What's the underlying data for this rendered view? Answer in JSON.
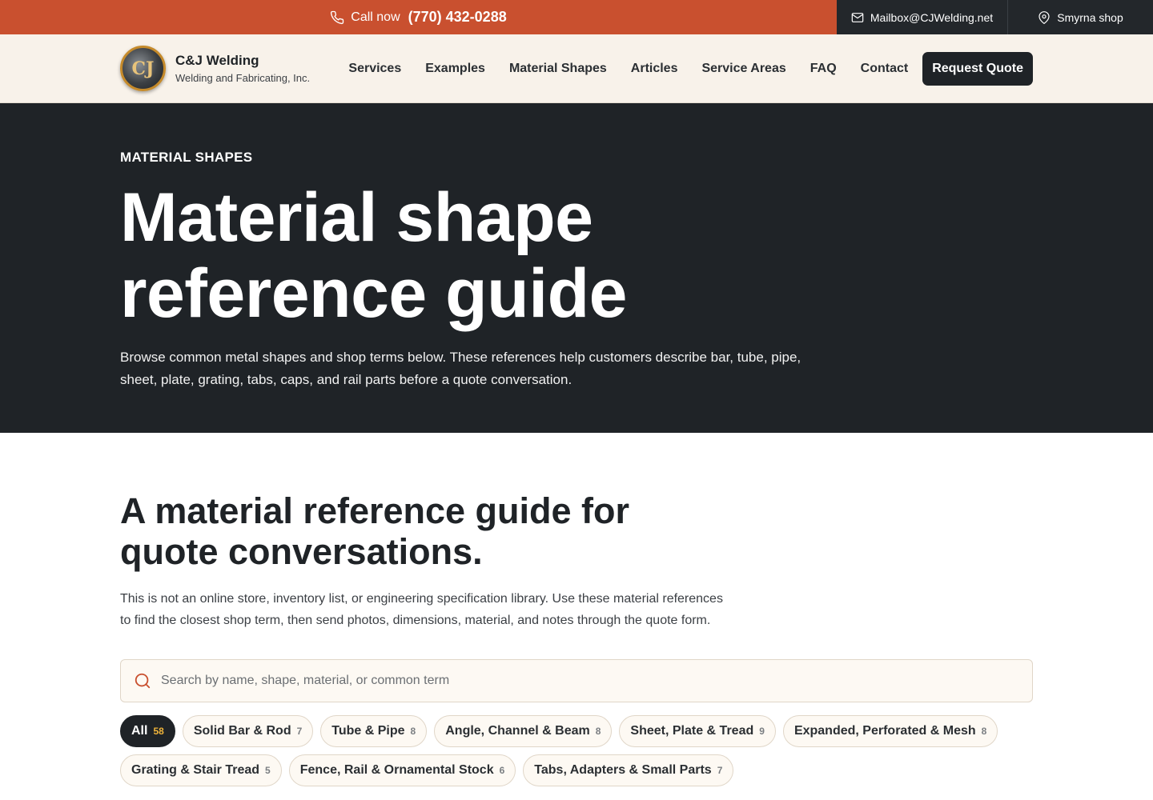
{
  "topbar": {
    "call_label": "Call now",
    "phone": "(770) 432-0288",
    "email": "Mailbox@CJWelding.net",
    "location": "Smyrna shop",
    "call_bg": "#c9502f",
    "dark_bg": "#23272b"
  },
  "header": {
    "logo_glyph": "CJ",
    "brand_name": "C&J Welding",
    "brand_sub": "Welding and Fabricating, Inc.",
    "nav": [
      {
        "label": "Services"
      },
      {
        "label": "Examples"
      },
      {
        "label": "Material Shapes"
      },
      {
        "label": "Articles"
      },
      {
        "label": "Service Areas"
      },
      {
        "label": "FAQ"
      },
      {
        "label": "Contact"
      }
    ],
    "quote_label": "Request Quote"
  },
  "hero": {
    "eyebrow": "MATERIAL SHAPES",
    "title_line1": "Material shape",
    "title_line2": "reference guide",
    "description": "Browse common metal shapes and shop terms below. These references help customers describe bar, tube, pipe, sheet, plate, grating, tabs, caps, and rail parts before a quote conversation."
  },
  "main": {
    "title": "A material reference guide for quote conversations.",
    "description": "This is not an online store, inventory list, or engineering specification library. Use these material references to find the closest shop term, then send photos, dimensions, material, and notes through the quote form.",
    "search_placeholder": "Search by name, shape, material, or common term",
    "search_value": "",
    "chips": [
      {
        "label": "All",
        "count": "58",
        "active": true
      },
      {
        "label": "Solid Bar & Rod",
        "count": "7"
      },
      {
        "label": "Tube & Pipe",
        "count": "8"
      },
      {
        "label": "Angle, Channel & Beam",
        "count": "8"
      },
      {
        "label": "Sheet, Plate & Tread",
        "count": "9"
      },
      {
        "label": "Expanded, Perforated & Mesh",
        "count": "8"
      },
      {
        "label": "Grating & Stair Tread",
        "count": "5"
      },
      {
        "label": "Fence, Rail & Ornamental Stock",
        "count": "6"
      },
      {
        "label": "Tabs, Adapters & Small Parts",
        "count": "7"
      }
    ]
  },
  "icons": {
    "phone": "phone-icon",
    "mail": "mail-icon",
    "location": "location-pin-icon",
    "search": "search-icon"
  },
  "colors": {
    "accent": "#c9502f",
    "dark": "#1f2327",
    "cream": "#f8f2ea",
    "count_highlight": "#f0b43a"
  }
}
